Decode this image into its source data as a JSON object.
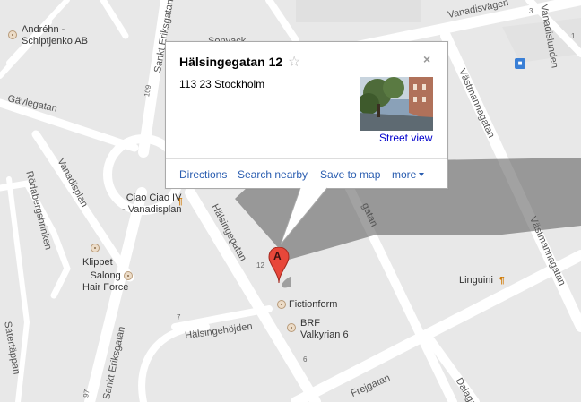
{
  "streets": {
    "vanadisvagen": "Vanadisvägen",
    "vanadislunden": "Vanadislunden",
    "sankt_eriksgatan_top": "Sankt Eriksgatan",
    "sankt_eriksgatan_bottom": "Sankt Eriksgatan",
    "gavlegatan": "Gävlegatan",
    "vanadisplan": "Vanadisplan",
    "rodabergsbrinken": "Rödabergsbrinken",
    "halsingegatan": "Hälsingegatan",
    "halsingehojden": "Hälsingehöjden",
    "saterstappan": "Sätertäppan",
    "vastmannagatan_top": "Västmannagatan",
    "vastmannagatan_right": "Västmannagatan",
    "frejgatan": "Frejgatan",
    "dalagatan": "Dalagatan",
    "street_mid": "gatan",
    "crossword_top": "Sonyack"
  },
  "street_numbers": {
    "n109": "109",
    "n12": "12",
    "n7": "7",
    "n6": "6",
    "n97": "97",
    "n3": "3",
    "n1": "1"
  },
  "places": {
    "andrehn_line1": "Andréhn -",
    "andrehn_line2": "Schiptjenko AB",
    "ciao_line1": "Ciao Ciao IV",
    "ciao_line2": "- Vanadisplan",
    "klippet": "Klippet",
    "salong_line1": "Salong",
    "salong_line2": "Hair Force",
    "fictionform": "Fictionform",
    "brf_line1": "BRF",
    "brf_line2": "Valkyrian 6",
    "linguini": "Linguini"
  },
  "info_window": {
    "title": "Hälsingegatan 12",
    "address": "113 23 Stockholm",
    "street_view_label": "Street view",
    "actions": {
      "directions": "Directions",
      "search_nearby": "Search nearby",
      "save_to_map": "Save to map",
      "more": "more"
    },
    "close_symbol": "×",
    "star_symbol": "☆"
  },
  "marker": {
    "label": "A",
    "color": "#e8473a"
  },
  "colors": {
    "map_bg": "#e8e8e8",
    "road": "#ffffff",
    "link": "#2a5db0"
  },
  "icons": {
    "bus": "bus-stop-icon",
    "restaurant": "fork-knife-icon"
  }
}
